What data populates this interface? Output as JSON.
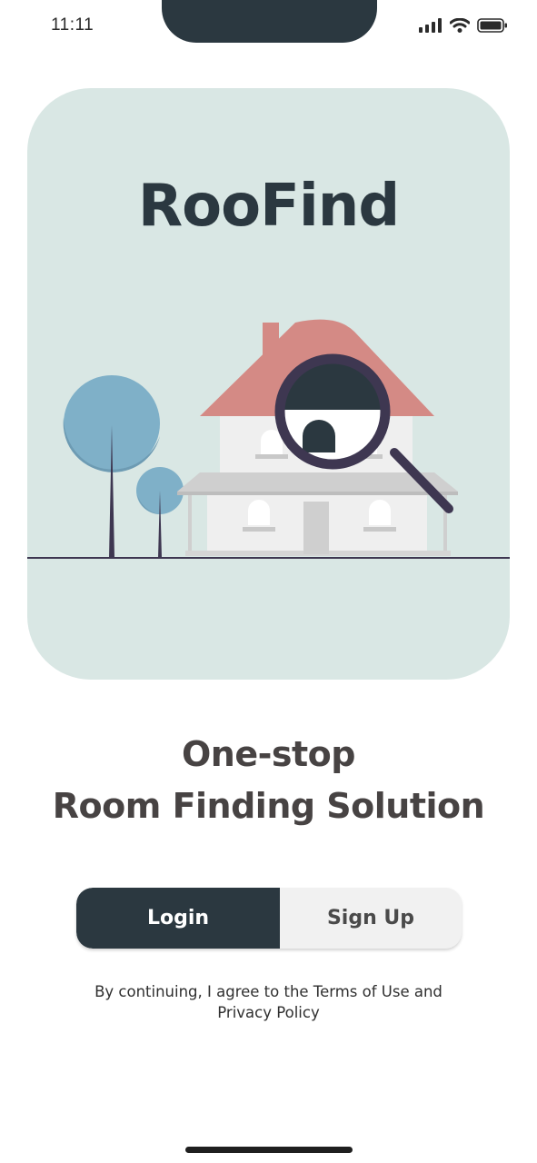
{
  "status_bar": {
    "time": "11:11"
  },
  "hero": {
    "title": "RooFind"
  },
  "tagline": {
    "line1": "One-stop",
    "line2": "Room Finding Solution"
  },
  "auth": {
    "login_label": "Login",
    "signup_label": "Sign Up",
    "selected": "Login"
  },
  "legal": {
    "line1": "By continuing, I agree to the Terms of Use and",
    "line2": "Privacy Policy"
  },
  "icons": {
    "signal": "cellular-signal-icon",
    "wifi": "wifi-icon",
    "battery": "battery-icon"
  },
  "colors": {
    "primary": "#2b3840",
    "hero_background": "#d9e7e4",
    "roof": "#d48a85",
    "tree": "#7fb0c8",
    "house_wall": "#efefef",
    "magnifier_frame": "#3e3751"
  }
}
